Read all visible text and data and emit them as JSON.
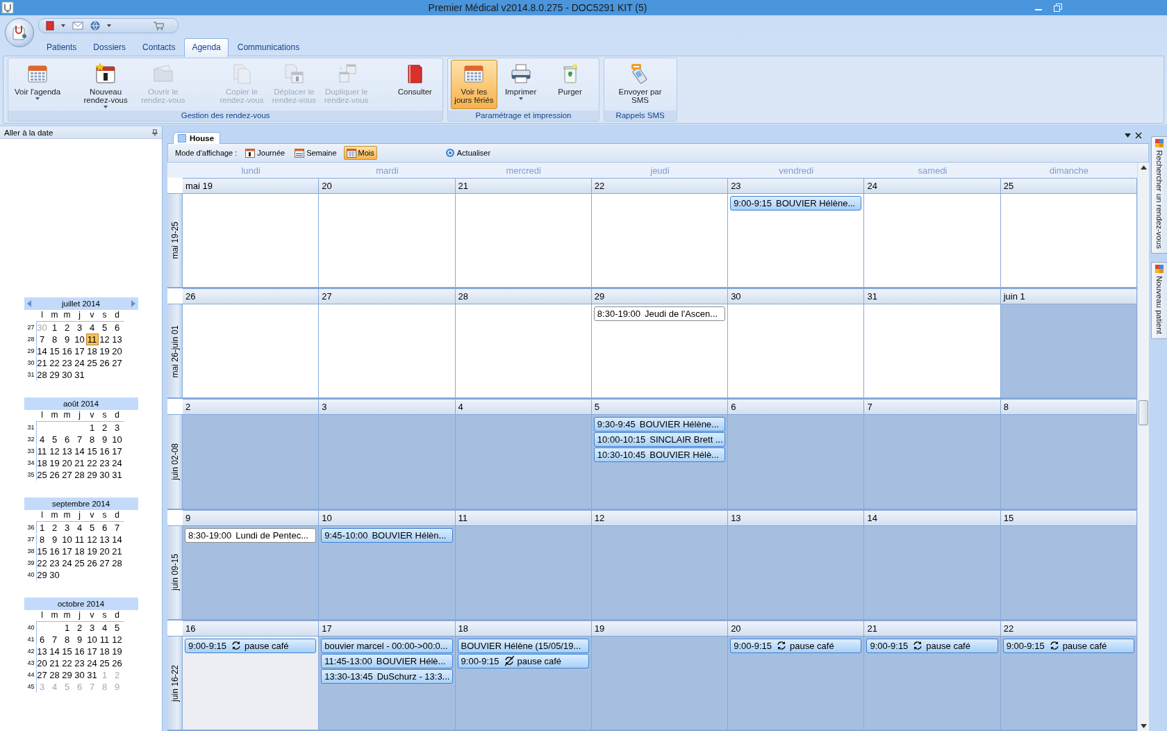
{
  "window": {
    "title": "Premier Médical v2014.8.0.275 - DOC5291 KIT (5)"
  },
  "ribbon_tabs": [
    {
      "label": "Patients",
      "selected": false
    },
    {
      "label": "Dossiers",
      "selected": false
    },
    {
      "label": "Contacts",
      "selected": false
    },
    {
      "label": "Agenda",
      "selected": true
    },
    {
      "label": "Communications",
      "selected": false
    }
  ],
  "ribbon_groups": [
    {
      "title": "Gestion des rendez-vous",
      "buttons": [
        {
          "label": "Voir l'agenda",
          "disabled": false,
          "dropdown": true,
          "pressed": false
        },
        {
          "label": "Nouveau\nrendez-vous",
          "disabled": false,
          "dropdown": true,
          "pressed": false
        },
        {
          "label": "Ouvrir le\nrendez-vous",
          "disabled": true,
          "dropdown": false,
          "pressed": false
        },
        {
          "label": "Copier le\nrendez-vous",
          "disabled": true,
          "dropdown": false,
          "pressed": false
        },
        {
          "label": "Déplacer le\nrendez-vous",
          "disabled": true,
          "dropdown": false,
          "pressed": false
        },
        {
          "label": "Dupliquer le\nrendez-vous",
          "disabled": true,
          "dropdown": false,
          "pressed": false
        },
        {
          "label": "Consulter",
          "disabled": false,
          "dropdown": false,
          "pressed": false
        }
      ]
    },
    {
      "title": "Paramétrage et impression",
      "buttons": [
        {
          "label": "Voir les\njours fériés",
          "disabled": false,
          "dropdown": false,
          "pressed": true
        },
        {
          "label": "Imprimer",
          "disabled": false,
          "dropdown": true,
          "pressed": false
        },
        {
          "label": "Purger",
          "disabled": false,
          "dropdown": false,
          "pressed": false
        }
      ]
    },
    {
      "title": "Rappels SMS",
      "buttons": [
        {
          "label": "Envoyer par\nSMS",
          "disabled": false,
          "dropdown": false,
          "pressed": false
        }
      ]
    }
  ],
  "date_panel": {
    "title": "Aller à la date",
    "months": [
      {
        "title": "juillet 2014",
        "arrows": true,
        "weekdays": [
          "l",
          "m",
          "m",
          "j",
          "v",
          "s",
          "d"
        ],
        "weeks": [
          {
            "number": "27",
            "days": [
              {
                "day": "30",
                "muted": true,
                "selected": false
              },
              {
                "day": "1",
                "muted": false,
                "selected": false
              },
              {
                "day": "2",
                "muted": false,
                "selected": false
              },
              {
                "day": "3",
                "muted": false,
                "selected": false
              },
              {
                "day": "4",
                "muted": false,
                "selected": false
              },
              {
                "day": "5",
                "muted": false,
                "selected": false
              },
              {
                "day": "6",
                "muted": false,
                "selected": false
              }
            ]
          },
          {
            "number": "28",
            "days": [
              {
                "day": "7",
                "muted": false,
                "selected": false
              },
              {
                "day": "8",
                "muted": false,
                "selected": false
              },
              {
                "day": "9",
                "muted": false,
                "selected": false
              },
              {
                "day": "10",
                "muted": false,
                "selected": false
              },
              {
                "day": "11",
                "muted": false,
                "selected": true
              },
              {
                "day": "12",
                "muted": false,
                "selected": false
              },
              {
                "day": "13",
                "muted": false,
                "selected": false
              }
            ]
          },
          {
            "number": "29",
            "days": [
              {
                "day": "14",
                "muted": false,
                "selected": false
              },
              {
                "day": "15",
                "muted": false,
                "selected": false
              },
              {
                "day": "16",
                "muted": false,
                "selected": false
              },
              {
                "day": "17",
                "muted": false,
                "selected": false
              },
              {
                "day": "18",
                "muted": false,
                "selected": false
              },
              {
                "day": "19",
                "muted": false,
                "selected": false
              },
              {
                "day": "20",
                "muted": false,
                "selected": false
              }
            ]
          },
          {
            "number": "30",
            "days": [
              {
                "day": "21",
                "muted": false,
                "selected": false
              },
              {
                "day": "22",
                "muted": false,
                "selected": false
              },
              {
                "day": "23",
                "muted": false,
                "selected": false
              },
              {
                "day": "24",
                "muted": false,
                "selected": false
              },
              {
                "day": "25",
                "muted": false,
                "selected": false
              },
              {
                "day": "26",
                "muted": false,
                "selected": false
              },
              {
                "day": "27",
                "muted": false,
                "selected": false
              }
            ]
          },
          {
            "number": "31",
            "days": [
              {
                "day": "28",
                "muted": false,
                "selected": false
              },
              {
                "day": "29",
                "muted": false,
                "selected": false
              },
              {
                "day": "30",
                "muted": false,
                "selected": false
              },
              {
                "day": "31",
                "muted": false,
                "selected": false
              }
            ]
          }
        ]
      },
      {
        "title": "août 2014",
        "arrows": false,
        "weekdays": [
          "l",
          "m",
          "m",
          "j",
          "v",
          "s",
          "d"
        ],
        "weeks": [
          {
            "number": "31",
            "right_aligned": true,
            "days": [
              {
                "day": "1",
                "muted": false,
                "selected": false
              },
              {
                "day": "2",
                "muted": false,
                "selected": false
              },
              {
                "day": "3",
                "muted": false,
                "selected": false
              }
            ]
          },
          {
            "number": "32",
            "days": [
              {
                "day": "4",
                "muted": false,
                "selected": false
              },
              {
                "day": "5",
                "muted": false,
                "selected": false
              },
              {
                "day": "6",
                "muted": false,
                "selected": false
              },
              {
                "day": "7",
                "muted": false,
                "selected": false
              },
              {
                "day": "8",
                "muted": false,
                "selected": false
              },
              {
                "day": "9",
                "muted": false,
                "selected": false
              },
              {
                "day": "10",
                "muted": false,
                "selected": false
              }
            ]
          },
          {
            "number": "33",
            "days": [
              {
                "day": "11",
                "muted": false,
                "selected": false
              },
              {
                "day": "12",
                "muted": false,
                "selected": false
              },
              {
                "day": "13",
                "muted": false,
                "selected": false
              },
              {
                "day": "14",
                "muted": false,
                "selected": false
              },
              {
                "day": "15",
                "muted": false,
                "selected": false
              },
              {
                "day": "16",
                "muted": false,
                "selected": false
              },
              {
                "day": "17",
                "muted": false,
                "selected": false
              }
            ]
          },
          {
            "number": "34",
            "days": [
              {
                "day": "18",
                "muted": false,
                "selected": false
              },
              {
                "day": "19",
                "muted": false,
                "selected": false
              },
              {
                "day": "20",
                "muted": false,
                "selected": false
              },
              {
                "day": "21",
                "muted": false,
                "selected": false
              },
              {
                "day": "22",
                "muted": false,
                "selected": false
              },
              {
                "day": "23",
                "muted": false,
                "selected": false
              },
              {
                "day": "24",
                "muted": false,
                "selected": false
              }
            ]
          },
          {
            "number": "35",
            "days": [
              {
                "day": "25",
                "muted": false,
                "selected": false
              },
              {
                "day": "26",
                "muted": false,
                "selected": false
              },
              {
                "day": "27",
                "muted": false,
                "selected": false
              },
              {
                "day": "28",
                "muted": false,
                "selected": false
              },
              {
                "day": "29",
                "muted": false,
                "selected": false
              },
              {
                "day": "30",
                "muted": false,
                "selected": false
              },
              {
                "day": "31",
                "muted": false,
                "selected": false
              }
            ]
          }
        ]
      },
      {
        "title": "septembre 2014",
        "arrows": false,
        "weekdays": [
          "l",
          "m",
          "m",
          "j",
          "v",
          "s",
          "d"
        ],
        "weeks": [
          {
            "number": "36",
            "days": [
              {
                "day": "1",
                "muted": false,
                "selected": false
              },
              {
                "day": "2",
                "muted": false,
                "selected": false
              },
              {
                "day": "3",
                "muted": false,
                "selected": false
              },
              {
                "day": "4",
                "muted": false,
                "selected": false
              },
              {
                "day": "5",
                "muted": false,
                "selected": false
              },
              {
                "day": "6",
                "muted": false,
                "selected": false
              },
              {
                "day": "7",
                "muted": false,
                "selected": false
              }
            ]
          },
          {
            "number": "37",
            "days": [
              {
                "day": "8",
                "muted": false,
                "selected": false
              },
              {
                "day": "9",
                "muted": false,
                "selected": false
              },
              {
                "day": "10",
                "muted": false,
                "selected": false
              },
              {
                "day": "11",
                "muted": false,
                "selected": false
              },
              {
                "day": "12",
                "muted": false,
                "selected": false
              },
              {
                "day": "13",
                "muted": false,
                "selected": false
              },
              {
                "day": "14",
                "muted": false,
                "selected": false
              }
            ]
          },
          {
            "number": "38",
            "days": [
              {
                "day": "15",
                "muted": false,
                "selected": false
              },
              {
                "day": "16",
                "muted": false,
                "selected": false
              },
              {
                "day": "17",
                "muted": false,
                "selected": false
              },
              {
                "day": "18",
                "muted": false,
                "selected": false
              },
              {
                "day": "19",
                "muted": false,
                "selected": false
              },
              {
                "day": "20",
                "muted": false,
                "selected": false
              },
              {
                "day": "21",
                "muted": false,
                "selected": false
              }
            ]
          },
          {
            "number": "39",
            "days": [
              {
                "day": "22",
                "muted": false,
                "selected": false
              },
              {
                "day": "23",
                "muted": false,
                "selected": false
              },
              {
                "day": "24",
                "muted": false,
                "selected": false
              },
              {
                "day": "25",
                "muted": false,
                "selected": false
              },
              {
                "day": "26",
                "muted": false,
                "selected": false
              },
              {
                "day": "27",
                "muted": false,
                "selected": false
              },
              {
                "day": "28",
                "muted": false,
                "selected": false
              }
            ]
          },
          {
            "number": "40",
            "days": [
              {
                "day": "29",
                "muted": false,
                "selected": false
              },
              {
                "day": "30",
                "muted": false,
                "selected": false
              }
            ]
          }
        ]
      },
      {
        "title": "octobre 2014",
        "arrows": false,
        "weekdays": [
          "l",
          "m",
          "m",
          "j",
          "v",
          "s",
          "d"
        ],
        "weeks": [
          {
            "number": "40",
            "right_aligned": true,
            "days": [
              {
                "day": "1",
                "muted": false,
                "selected": false
              },
              {
                "day": "2",
                "muted": false,
                "selected": false
              },
              {
                "day": "3",
                "muted": false,
                "selected": false
              },
              {
                "day": "4",
                "muted": false,
                "selected": false
              },
              {
                "day": "5",
                "muted": false,
                "selected": false
              }
            ]
          },
          {
            "number": "41",
            "days": [
              {
                "day": "6",
                "muted": false,
                "selected": false
              },
              {
                "day": "7",
                "muted": false,
                "selected": false
              },
              {
                "day": "8",
                "muted": false,
                "selected": false
              },
              {
                "day": "9",
                "muted": false,
                "selected": false
              },
              {
                "day": "10",
                "muted": false,
                "selected": false
              },
              {
                "day": "11",
                "muted": false,
                "selected": false
              },
              {
                "day": "12",
                "muted": false,
                "selected": false
              }
            ]
          },
          {
            "number": "42",
            "days": [
              {
                "day": "13",
                "muted": false,
                "selected": false
              },
              {
                "day": "14",
                "muted": false,
                "selected": false
              },
              {
                "day": "15",
                "muted": false,
                "selected": false
              },
              {
                "day": "16",
                "muted": false,
                "selected": false
              },
              {
                "day": "17",
                "muted": false,
                "selected": false
              },
              {
                "day": "18",
                "muted": false,
                "selected": false
              },
              {
                "day": "19",
                "muted": false,
                "selected": false
              }
            ]
          },
          {
            "number": "43",
            "days": [
              {
                "day": "20",
                "muted": false,
                "selected": false
              },
              {
                "day": "21",
                "muted": false,
                "selected": false
              },
              {
                "day": "22",
                "muted": false,
                "selected": false
              },
              {
                "day": "23",
                "muted": false,
                "selected": false
              },
              {
                "day": "24",
                "muted": false,
                "selected": false
              },
              {
                "day": "25",
                "muted": false,
                "selected": false
              },
              {
                "day": "26",
                "muted": false,
                "selected": false
              }
            ]
          },
          {
            "number": "44",
            "days": [
              {
                "day": "27",
                "muted": false,
                "selected": false
              },
              {
                "day": "28",
                "muted": false,
                "selected": false
              },
              {
                "day": "29",
                "muted": false,
                "selected": false
              },
              {
                "day": "30",
                "muted": false,
                "selected": false
              },
              {
                "day": "31",
                "muted": false,
                "selected": false
              },
              {
                "day": "1",
                "muted": true,
                "selected": false
              },
              {
                "day": "2",
                "muted": true,
                "selected": false
              }
            ]
          },
          {
            "number": "45",
            "days": [
              {
                "day": "3",
                "muted": true,
                "selected": false
              },
              {
                "day": "4",
                "muted": true,
                "selected": false
              },
              {
                "day": "5",
                "muted": true,
                "selected": false
              },
              {
                "day": "6",
                "muted": true,
                "selected": false
              },
              {
                "day": "7",
                "muted": true,
                "selected": false
              },
              {
                "day": "8",
                "muted": true,
                "selected": false
              },
              {
                "day": "9",
                "muted": true,
                "selected": false
              }
            ]
          }
        ]
      }
    ]
  },
  "agenda": {
    "tab": "House",
    "mode_label": "Mode d'affichage :",
    "modes": [
      {
        "label": "Journée",
        "selected": false
      },
      {
        "label": "Semaine",
        "selected": false
      },
      {
        "label": "Mois",
        "selected": true
      }
    ],
    "refresh": "Actualiser",
    "weekdays": [
      "lundi",
      "mardi",
      "mercredi",
      "jeudi",
      "vendredi",
      "samedi",
      "dimanche"
    ],
    "weeks": [
      {
        "label": "mai 19-25",
        "days": [
          {
            "date": "mai 19",
            "shaded": false,
            "selected": false
          },
          {
            "date": "20",
            "shaded": false,
            "selected": false
          },
          {
            "date": "21",
            "shaded": false,
            "selected": false
          },
          {
            "date": "22",
            "shaded": false,
            "selected": false
          },
          {
            "date": "23",
            "shaded": false,
            "selected": false,
            "appointments": [
              {
                "kind": "appointment",
                "time": "9:00-9:15",
                "title": "BOUVIER Hélène..."
              }
            ]
          },
          {
            "date": "24",
            "shaded": false,
            "selected": false
          },
          {
            "date": "25",
            "shaded": false,
            "selected": false
          }
        ]
      },
      {
        "label": "mai 26-juin 01",
        "days": [
          {
            "date": "26",
            "shaded": false,
            "selected": false
          },
          {
            "date": "27",
            "shaded": false,
            "selected": false
          },
          {
            "date": "28",
            "shaded": false,
            "selected": false
          },
          {
            "date": "29",
            "shaded": false,
            "selected": false,
            "appointments": [
              {
                "kind": "holiday",
                "time": "8:30-19:00",
                "title": "Jeudi de l'Ascen..."
              }
            ]
          },
          {
            "date": "30",
            "shaded": false,
            "selected": false
          },
          {
            "date": "31",
            "shaded": false,
            "selected": false
          },
          {
            "date": "juin 1",
            "shaded": true,
            "selected": false
          }
        ]
      },
      {
        "label": "juin 02-08",
        "days": [
          {
            "date": "2",
            "shaded": true,
            "selected": false
          },
          {
            "date": "3",
            "shaded": true,
            "selected": false
          },
          {
            "date": "4",
            "shaded": true,
            "selected": false
          },
          {
            "date": "5",
            "shaded": true,
            "selected": false,
            "appointments": [
              {
                "kind": "appointment",
                "time": "9:30-9:45",
                "title": "BOUVIER Hélène..."
              },
              {
                "kind": "appointment",
                "time": "10:00-10:15",
                "title": "SINCLAIR Brett ..."
              },
              {
                "kind": "appointment",
                "time": "10:30-10:45",
                "title": "BOUVIER Hélè..."
              }
            ]
          },
          {
            "date": "6",
            "shaded": true,
            "selected": false
          },
          {
            "date": "7",
            "shaded": true,
            "selected": false
          },
          {
            "date": "8",
            "shaded": true,
            "selected": false
          }
        ]
      },
      {
        "label": "juin 09-15",
        "days": [
          {
            "date": "9",
            "shaded": true,
            "selected": false,
            "appointments": [
              {
                "kind": "holiday",
                "time": "8:30-19:00",
                "title": "Lundi de Pentec..."
              }
            ]
          },
          {
            "date": "10",
            "shaded": true,
            "selected": false,
            "appointments": [
              {
                "kind": "appointment",
                "time": "9:45-10:00",
                "title": "BOUVIER Hélèn..."
              }
            ]
          },
          {
            "date": "11",
            "shaded": true,
            "selected": false
          },
          {
            "date": "12",
            "shaded": true,
            "selected": false
          },
          {
            "date": "13",
            "shaded": true,
            "selected": false
          },
          {
            "date": "14",
            "shaded": true,
            "selected": false
          },
          {
            "date": "15",
            "shaded": true,
            "selected": false
          }
        ]
      },
      {
        "label": "juin 16-22",
        "days": [
          {
            "date": "16",
            "shaded": false,
            "selected": true,
            "appointments": [
              {
                "kind": "appointment",
                "time": "9:00-9:15",
                "recurring": true,
                "title": "pause café"
              }
            ]
          },
          {
            "date": "17",
            "shaded": true,
            "selected": false,
            "appointments": [
              {
                "kind": "appointment",
                "title": "bouvier marcel - 00:00->00:0..."
              },
              {
                "kind": "appointment",
                "time": "11:45-13:00",
                "title": "BOUVIER Hélè..."
              },
              {
                "kind": "appointment",
                "time": "13:30-13:45",
                "title": "DuSchurz - 13:3..."
              }
            ]
          },
          {
            "date": "18",
            "shaded": true,
            "selected": false,
            "appointments": [
              {
                "kind": "appointment",
                "title": "BOUVIER Hélène (15/05/19..."
              },
              {
                "kind": "appointment",
                "time": "9:00-9:15",
                "recurring": true,
                "exception": true,
                "title": "pause café"
              }
            ]
          },
          {
            "date": "19",
            "shaded": true,
            "selected": false
          },
          {
            "date": "20",
            "shaded": true,
            "selected": false,
            "appointments": [
              {
                "kind": "appointment",
                "time": "9:00-9:15",
                "recurring": true,
                "title": "pause café"
              }
            ]
          },
          {
            "date": "21",
            "shaded": true,
            "selected": false,
            "appointments": [
              {
                "kind": "appointment",
                "time": "9:00-9:15",
                "recurring": true,
                "title": "pause café"
              }
            ]
          },
          {
            "date": "22",
            "shaded": true,
            "selected": false,
            "appointments": [
              {
                "kind": "appointment",
                "time": "9:00-9:15",
                "recurring": true,
                "title": "pause café"
              }
            ]
          }
        ]
      }
    ]
  },
  "side_tabs": [
    {
      "label": "Rechercher un rendez-vous"
    },
    {
      "label": "Nouveau patient"
    }
  ]
}
